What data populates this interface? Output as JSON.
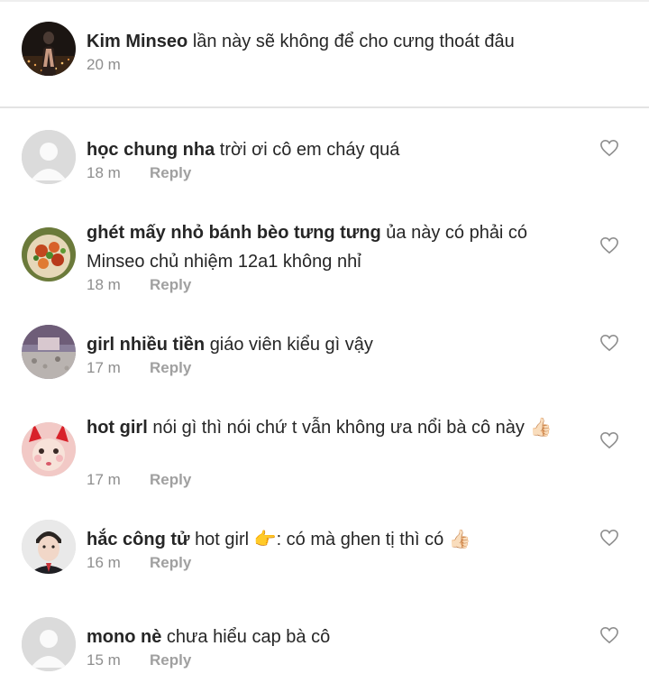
{
  "caption": {
    "username": "Kim Minseo",
    "text": "lần này sẽ không để cho cưng thoát đâu",
    "time": "20 m"
  },
  "comments": [
    {
      "username": "học chung nha",
      "text": "trời ơi cô em cháy quá",
      "time": "18 m",
      "reply_label": "Reply",
      "avatar": "default-avatar"
    },
    {
      "username": "ghét mấy nhỏ bánh bèo tưng tưng",
      "text": "ủa này có phải có Minseo chủ nhiệm 12a1 không nhỉ",
      "time": "18 m",
      "reply_label": "Reply",
      "avatar": "food-photo-avatar"
    },
    {
      "username": "girl nhiều tiền",
      "text": "giáo viên kiểu gì vậy",
      "time": "17 m",
      "reply_label": "Reply",
      "avatar": "room-photo-avatar"
    },
    {
      "username": "hot girl",
      "text": "nói gì thì nói chứ t vẫn không ưa nổi bà cô này",
      "emoji": "👍🏻",
      "time": "17 m",
      "reply_label": "Reply",
      "avatar": "girl-filter-avatar"
    },
    {
      "username": "hắc công tử",
      "text_before": "hot girl",
      "emoji_mid": "👉",
      "text_after": ": có mà ghen tị thì có",
      "emoji_end": "👍🏻",
      "time": "16 m",
      "reply_label": "Reply",
      "avatar": "boy-photo-avatar"
    },
    {
      "username": "mono nè",
      "text": "chưa hiểu cap bà cô",
      "time": "15 m",
      "reply_label": "Reply",
      "avatar": "default-avatar"
    }
  ]
}
